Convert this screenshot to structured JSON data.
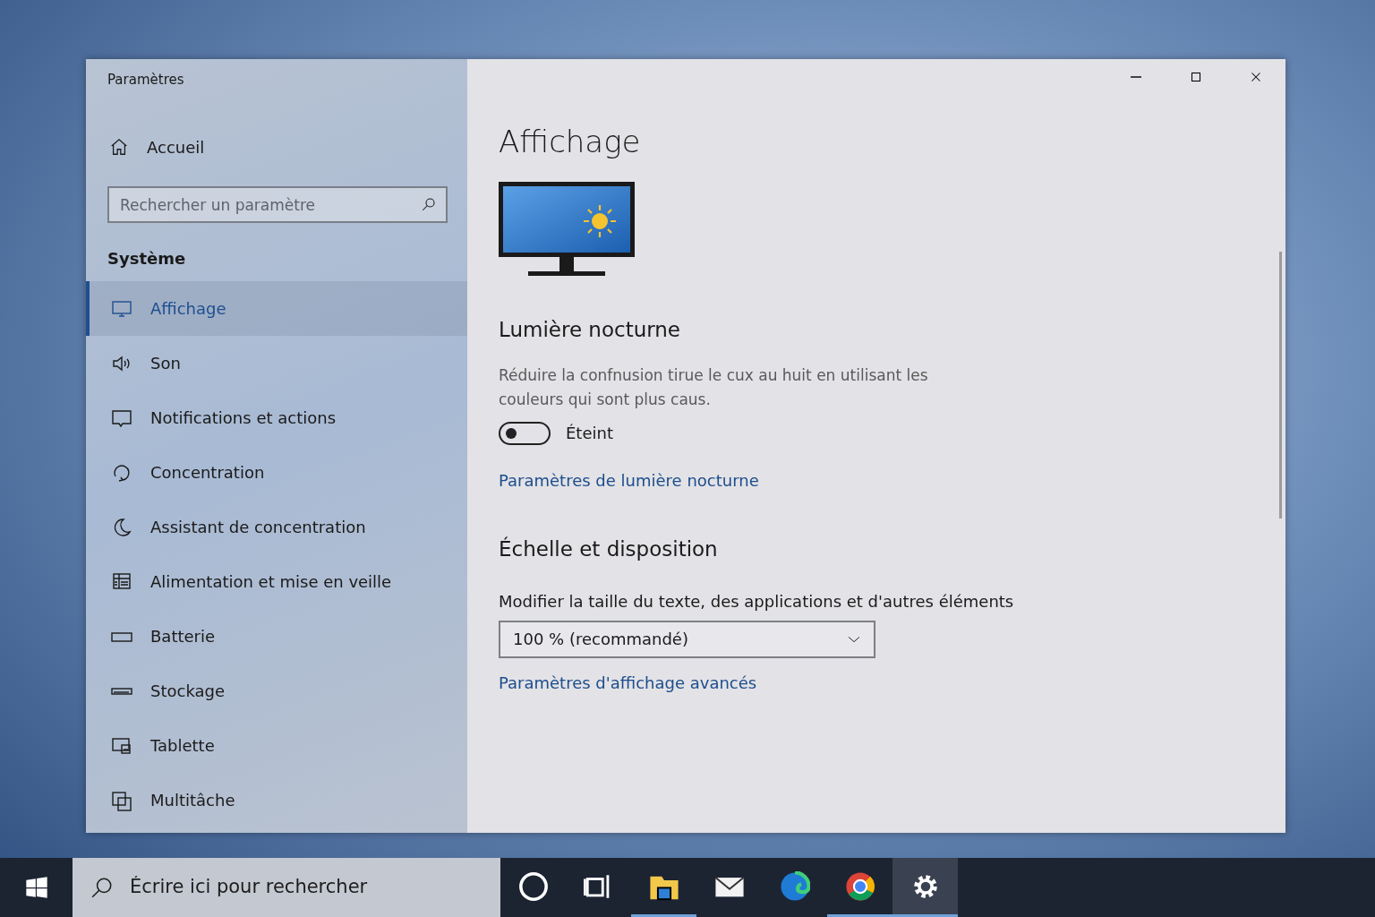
{
  "window": {
    "title": "Paramètres"
  },
  "sidebar": {
    "home": {
      "label": "Accueil"
    },
    "search": {
      "placeholder": "Rechercher un paramètre"
    },
    "section": "Système",
    "items": [
      {
        "label": "Affichage",
        "kind": "monitor",
        "selected": true
      },
      {
        "label": "Son",
        "kind": "speaker",
        "selected": false
      },
      {
        "label": "Notifications et actions",
        "kind": "message",
        "selected": false
      },
      {
        "label": "Concentration",
        "kind": "focus",
        "selected": false
      },
      {
        "label": "Assistant de concentration",
        "kind": "moon",
        "selected": false
      },
      {
        "label": "Alimentation et mise en veille",
        "kind": "power",
        "selected": false
      },
      {
        "label": "Batterie",
        "kind": "battery",
        "selected": false
      },
      {
        "label": "Stockage",
        "kind": "drive",
        "selected": false
      },
      {
        "label": "Tablette",
        "kind": "tablet",
        "selected": false
      },
      {
        "label": "Multitâche",
        "kind": "multitask",
        "selected": false
      }
    ]
  },
  "main": {
    "title": "Affichage",
    "night_light": {
      "heading": "Lumière nocturne",
      "description": "Réduire la confnusion tirue le cux au huit en utilisant les couleurs qui sont plus caus.",
      "toggle": {
        "on": false,
        "label": "Éteint"
      },
      "link": "Paramètres de lumière nocturne"
    },
    "scale": {
      "heading": "Échelle et disposition",
      "label": "Modifier la taille du texte, des applications et d'autres éléments",
      "dropdown": {
        "value": "100 % (recommandé)"
      },
      "link": "Paramètres d'affichage avancés"
    }
  },
  "taskbar": {
    "search": {
      "placeholder": "Écrire ici pour rechercher"
    },
    "apps": [
      {
        "kind": "cortana",
        "running": false,
        "selected": false
      },
      {
        "kind": "taskview",
        "running": false,
        "selected": false
      },
      {
        "kind": "folder",
        "running": true,
        "selected": false
      },
      {
        "kind": "mail",
        "running": false,
        "selected": false
      },
      {
        "kind": "edge",
        "running": false,
        "selected": false
      },
      {
        "kind": "chrome",
        "running": true,
        "selected": false
      },
      {
        "kind": "settings",
        "running": true,
        "selected": true
      }
    ]
  }
}
